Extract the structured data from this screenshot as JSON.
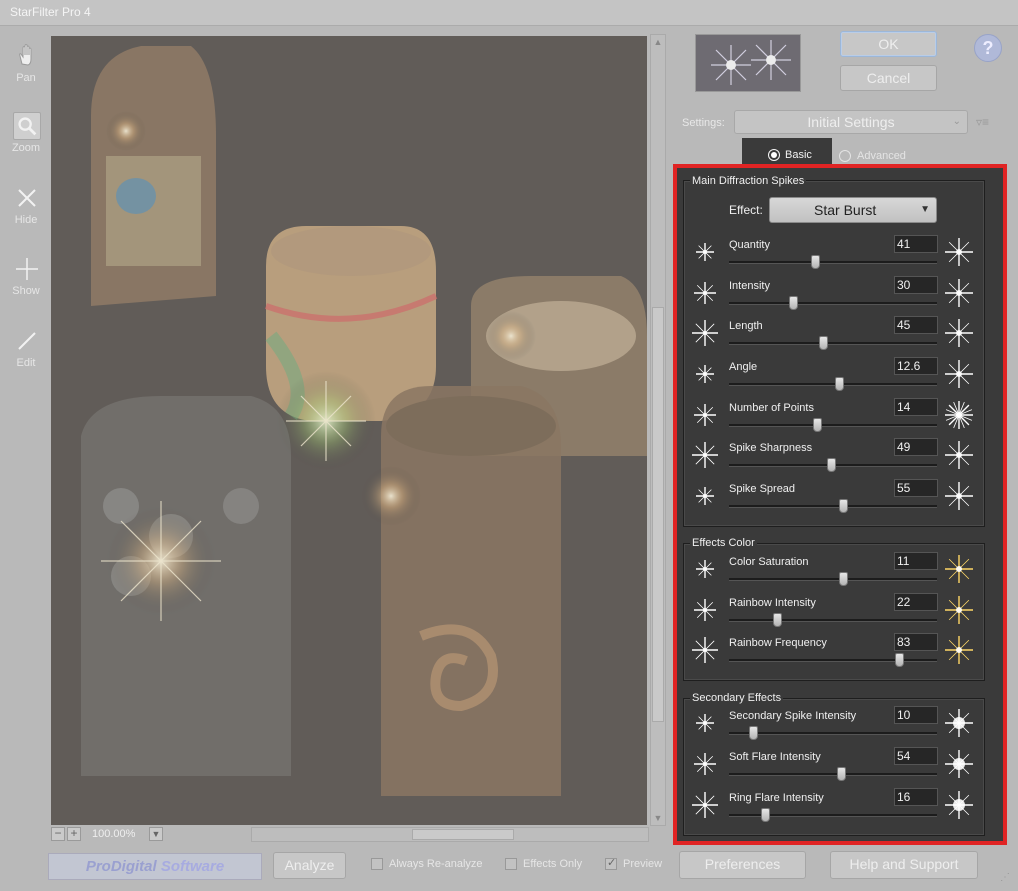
{
  "window": {
    "title": "StarFilter Pro 4"
  },
  "tools": [
    {
      "label": "Pan",
      "icon": "hand-icon"
    },
    {
      "label": "Zoom",
      "icon": "magnifier-icon"
    },
    {
      "label": "Hide",
      "icon": "x-icon"
    },
    {
      "label": "Show",
      "icon": "plus-icon"
    },
    {
      "label": "Edit",
      "icon": "pencil-icon"
    }
  ],
  "view": {
    "zoom": "100.00%"
  },
  "buttons": {
    "ok": "OK",
    "cancel": "Cancel",
    "help": "?",
    "preferences": "Preferences",
    "help_support": "Help and Support",
    "analyze": "Analyze"
  },
  "settings": {
    "label": "Settings:",
    "value": "Initial Settings"
  },
  "tabs": {
    "basic": "Basic",
    "advanced": "Advanced",
    "selected": "Basic"
  },
  "groups": {
    "main": {
      "title": "Main Diffraction Spikes",
      "effect_label": "Effect:",
      "effect_value": "Star Burst",
      "sliders": [
        {
          "label": "Quantity",
          "value": "41",
          "fraction": 0.41
        },
        {
          "label": "Intensity",
          "value": "30",
          "fraction": 0.3
        },
        {
          "label": "Length",
          "value": "45",
          "fraction": 0.45
        },
        {
          "label": "Angle",
          "value": "12.6",
          "fraction": 0.53
        },
        {
          "label": "Number of Points",
          "value": "14",
          "fraction": 0.42
        },
        {
          "label": "Spike Sharpness",
          "value": "49",
          "fraction": 0.49
        },
        {
          "label": "Spike Spread",
          "value": "55",
          "fraction": 0.55
        }
      ]
    },
    "color": {
      "title": "Effects Color",
      "sliders": [
        {
          "label": "Color Saturation",
          "value": "11",
          "fraction": 0.55
        },
        {
          "label": "Rainbow Intensity",
          "value": "22",
          "fraction": 0.22
        },
        {
          "label": "Rainbow Frequency",
          "value": "83",
          "fraction": 0.83
        }
      ]
    },
    "secondary": {
      "title": "Secondary Effects",
      "sliders": [
        {
          "label": "Secondary Spike Intensity",
          "value": "10",
          "fraction": 0.1
        },
        {
          "label": "Soft Flare Intensity",
          "value": "54",
          "fraction": 0.54
        },
        {
          "label": "Ring Flare Intensity",
          "value": "16",
          "fraction": 0.16
        }
      ]
    }
  },
  "footer": {
    "brand_a": "ProDigital",
    "brand_b": " Software",
    "always_reanalyze": "Always Re-analyze",
    "effects_only": "Effects Only",
    "preview": "Preview",
    "preview_checked": true
  },
  "colors": {
    "highlight": "#e02424",
    "panel": "#3a3a3a"
  }
}
